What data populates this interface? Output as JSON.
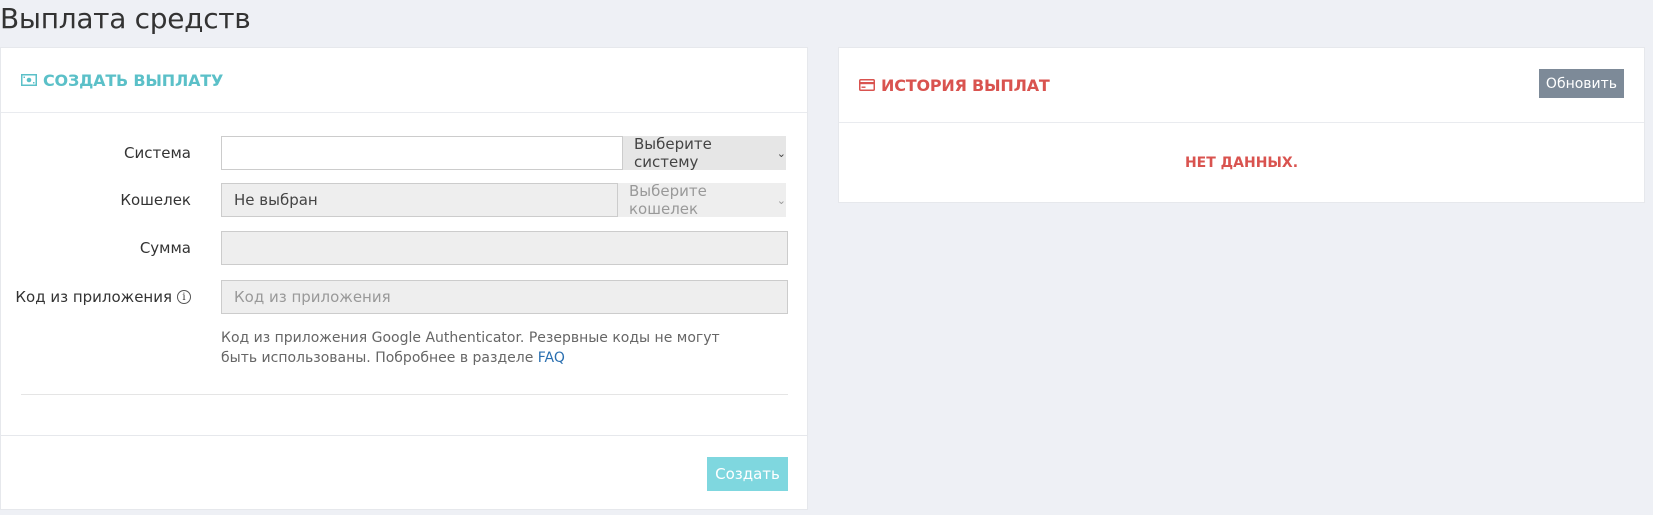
{
  "page_title": "Выплата средств",
  "create_panel": {
    "title": "СОЗДАТЬ ВЫПЛАТУ",
    "icon": "money-icon",
    "fields": {
      "system": {
        "label": "Система",
        "value": "",
        "addon": "Выберите систему"
      },
      "wallet": {
        "label": "Кошелек",
        "value": "Не выбран",
        "addon": "Выберите кошелек"
      },
      "amount": {
        "label": "Сумма",
        "value": ""
      },
      "code": {
        "label": "Код из приложения",
        "placeholder": "Код из приложения"
      }
    },
    "help_text": "Код из приложения Google Authenticator. Резервные коды не могут быть использованы. Побробнее в разделе ",
    "help_link": "FAQ",
    "submit_label": "Создать"
  },
  "history_panel": {
    "title": "ИСТОРИЯ ВЫПЛАТ",
    "icon": "credit-card-icon",
    "refresh_label": "Обновить",
    "empty_text": "НЕТ ДАННЫХ."
  },
  "colors": {
    "accent_teal": "#5bc0c8",
    "accent_red": "#d9534f",
    "button_grey": "#7d8a98",
    "button_teal": "#7fd7df"
  }
}
